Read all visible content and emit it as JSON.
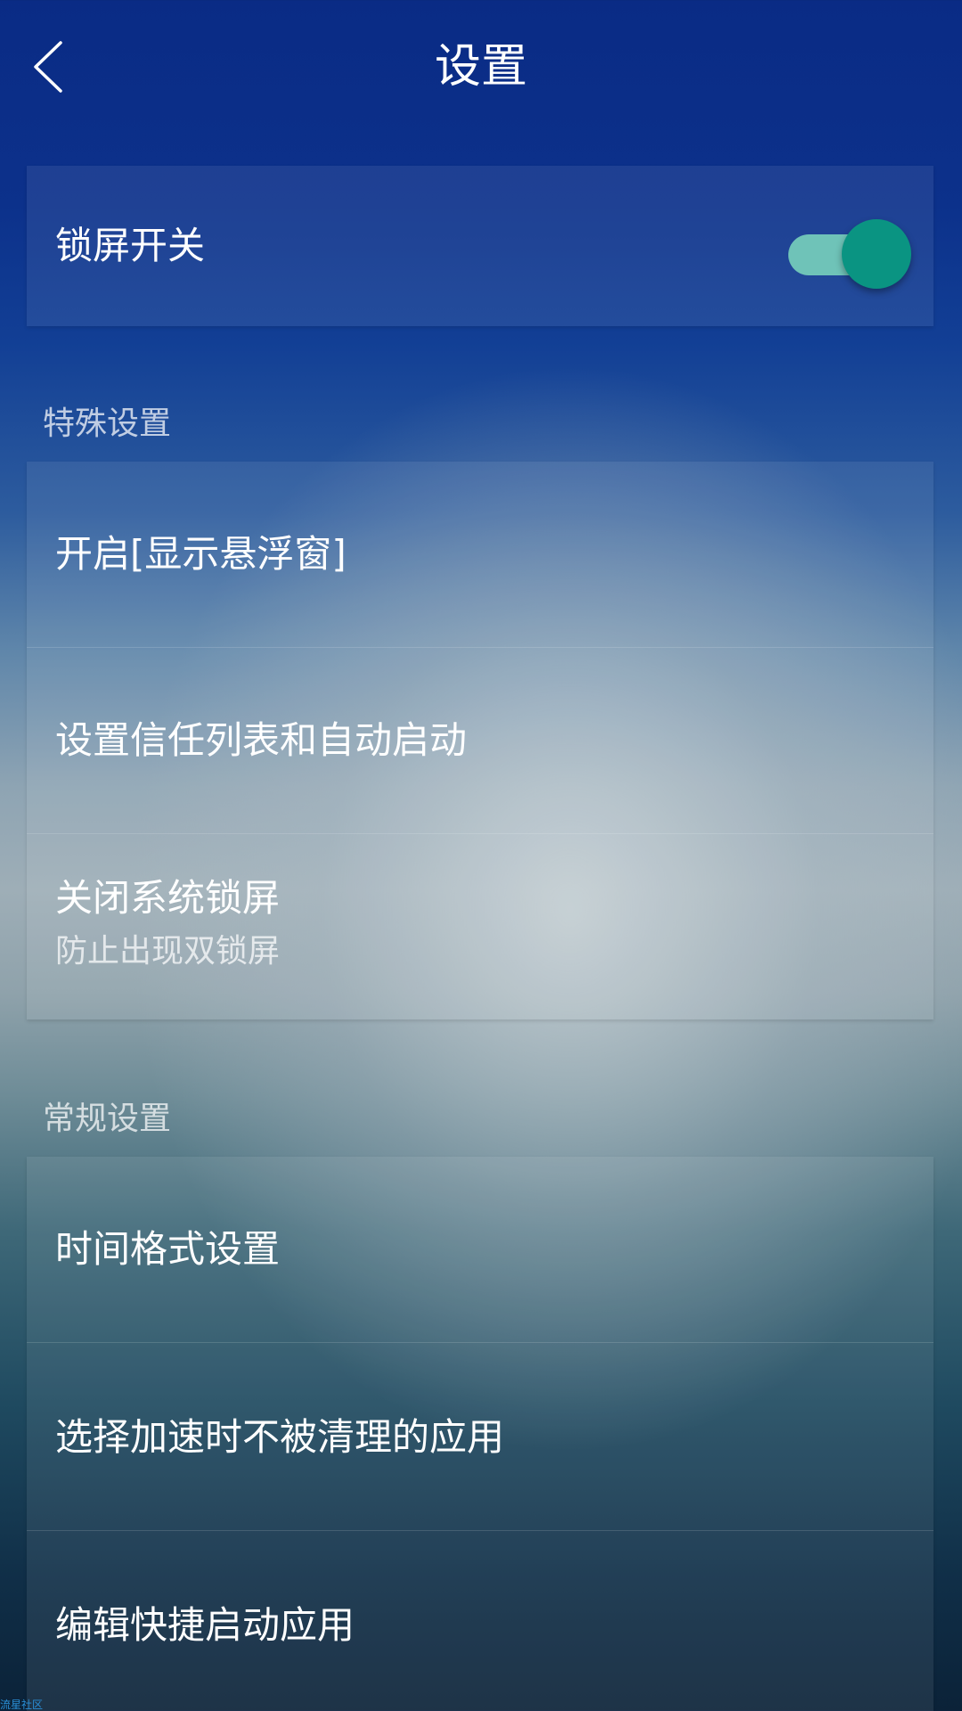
{
  "header": {
    "title": "设置",
    "back_icon": "chevron-left-icon"
  },
  "lock_card": {
    "label": "锁屏开关",
    "toggle_on": true,
    "toggle_track_color": "#6fc3b8",
    "toggle_thumb_color": "#0a9482"
  },
  "special_section": {
    "title": "特殊设置",
    "items": [
      {
        "label": "开启[显示悬浮窗]"
      },
      {
        "label": "设置信任列表和自动启动"
      },
      {
        "label": "关闭系统锁屏",
        "sub": "防止出现双锁屏"
      }
    ]
  },
  "general_section": {
    "title": "常规设置",
    "items": [
      {
        "label": "时间格式设置"
      },
      {
        "label": "选择加速时不被清理的应用"
      },
      {
        "label": "编辑快捷启动应用"
      }
    ]
  },
  "watermark": "流星社区"
}
